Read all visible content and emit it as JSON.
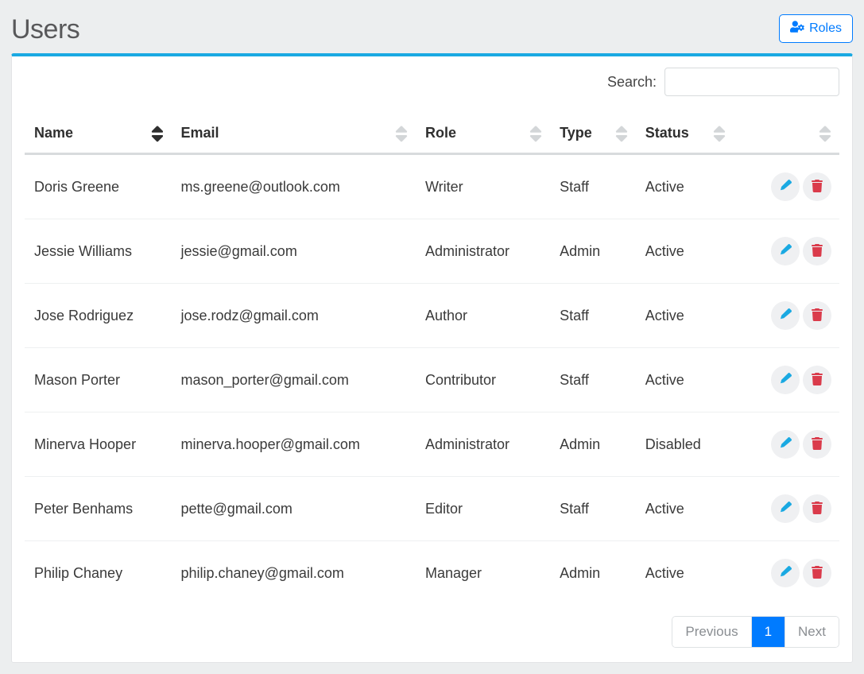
{
  "page": {
    "title": "Users"
  },
  "roles_button": {
    "label": "Roles"
  },
  "search": {
    "label": "Search:",
    "value": ""
  },
  "columns": {
    "name": "Name",
    "email": "Email",
    "role": "Role",
    "type": "Type",
    "status": "Status"
  },
  "users": [
    {
      "name": "Doris Greene",
      "email": "ms.greene@outlook.com",
      "role": "Writer",
      "type": "Staff",
      "status": "Active"
    },
    {
      "name": "Jessie Williams",
      "email": "jessie@gmail.com",
      "role": "Administrator",
      "type": "Admin",
      "status": "Active"
    },
    {
      "name": "Jose Rodriguez",
      "email": "jose.rodz@gmail.com",
      "role": "Author",
      "type": "Staff",
      "status": "Active"
    },
    {
      "name": "Mason Porter",
      "email": "mason_porter@gmail.com",
      "role": "Contributor",
      "type": "Staff",
      "status": "Active"
    },
    {
      "name": "Minerva Hooper",
      "email": "minerva.hooper@gmail.com",
      "role": "Administrator",
      "type": "Admin",
      "status": "Disabled"
    },
    {
      "name": "Peter Benhams",
      "email": "pette@gmail.com",
      "role": "Editor",
      "type": "Staff",
      "status": "Active"
    },
    {
      "name": "Philip Chaney",
      "email": "philip.chaney@gmail.com",
      "role": "Manager",
      "type": "Admin",
      "status": "Active"
    }
  ],
  "pagination": {
    "previous": "Previous",
    "next": "Next",
    "current": "1"
  },
  "icons": {
    "edit": "edit-icon",
    "delete": "trash-icon",
    "sort": "sort-icon",
    "roles": "user-cog-icon"
  }
}
